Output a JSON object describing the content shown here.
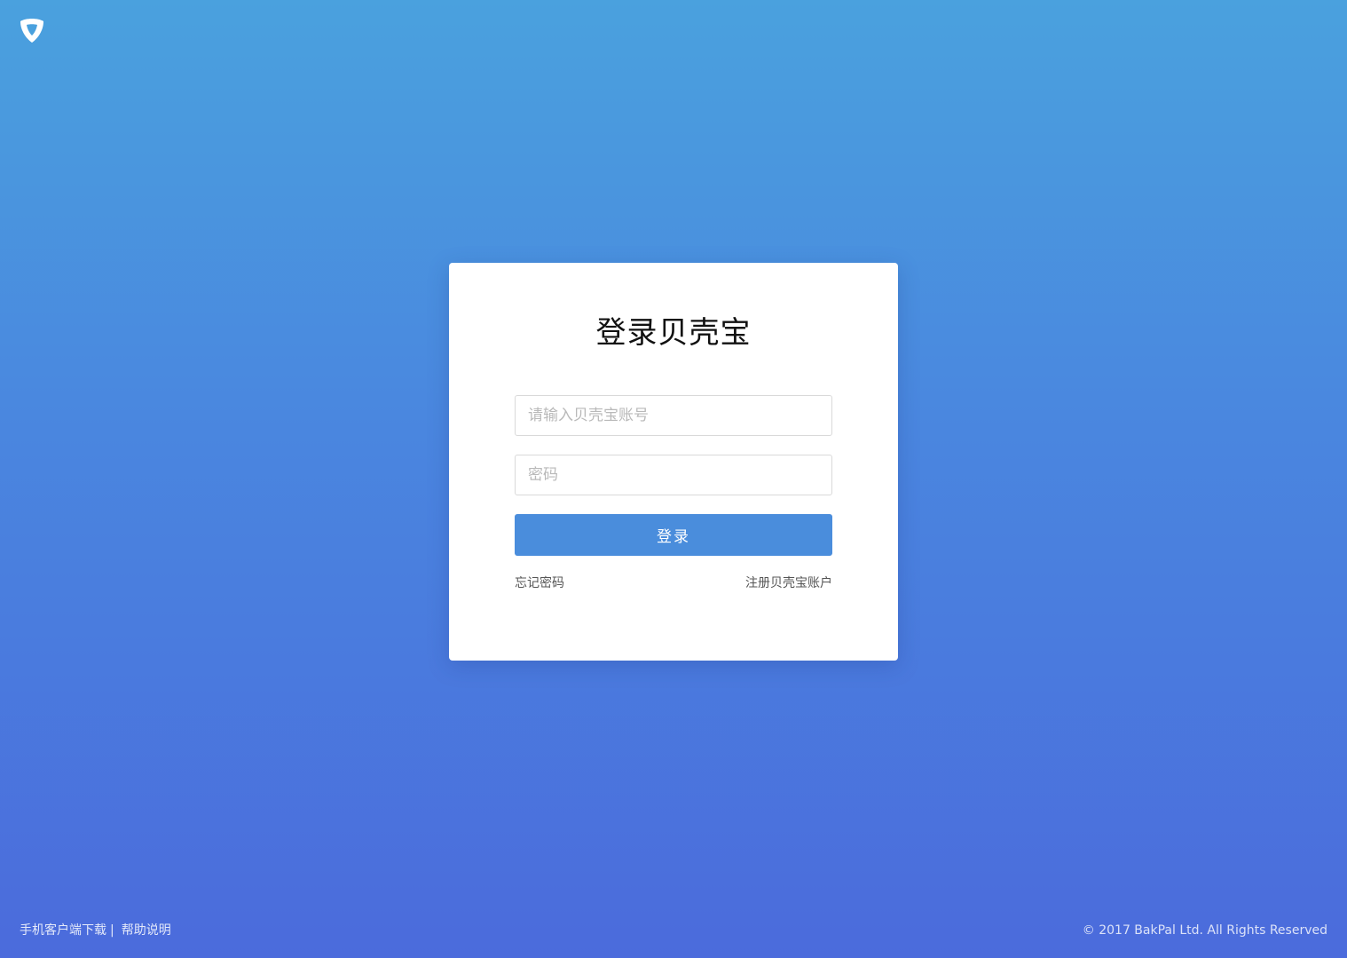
{
  "brand": {
    "logo_icon": "bakpal-shield-logo-icon"
  },
  "login": {
    "title": "登录贝壳宝",
    "account_placeholder": "请输入贝壳宝账号",
    "account_value": "",
    "password_placeholder": "密码",
    "password_value": "",
    "submit_label": "登录",
    "forgot_password": "忘记密码",
    "register_account": "注册贝壳宝账户",
    "button_color": "#4a8ddc"
  },
  "footer": {
    "mobile_download": "手机客户端下载",
    "separator": "|",
    "help": "帮助说明",
    "copyright": "© 2017 BakPal Ltd. All Rights Reserved"
  },
  "colors": {
    "background_top": "#4aa1de",
    "background_bottom": "#4b6bdc"
  }
}
